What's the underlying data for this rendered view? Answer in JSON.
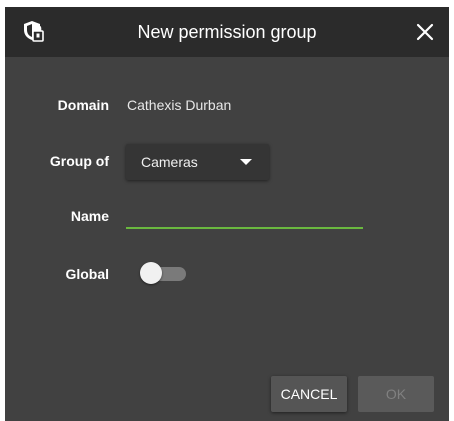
{
  "dialog": {
    "title": "New permission group",
    "icons": {
      "title": "security-shield-icon",
      "close": "close-icon"
    }
  },
  "form": {
    "domain": {
      "label": "Domain",
      "value": "Cathexis Durban"
    },
    "group_of": {
      "label": "Group of",
      "selected": "Cameras"
    },
    "name": {
      "label": "Name",
      "value": "",
      "placeholder": ""
    },
    "global": {
      "label": "Global",
      "on": false
    }
  },
  "buttons": {
    "cancel": "CANCEL",
    "ok": "OK"
  },
  "colors": {
    "titlebar": "#2b2b2b",
    "body": "#414141",
    "accent": "#6ab83f"
  }
}
